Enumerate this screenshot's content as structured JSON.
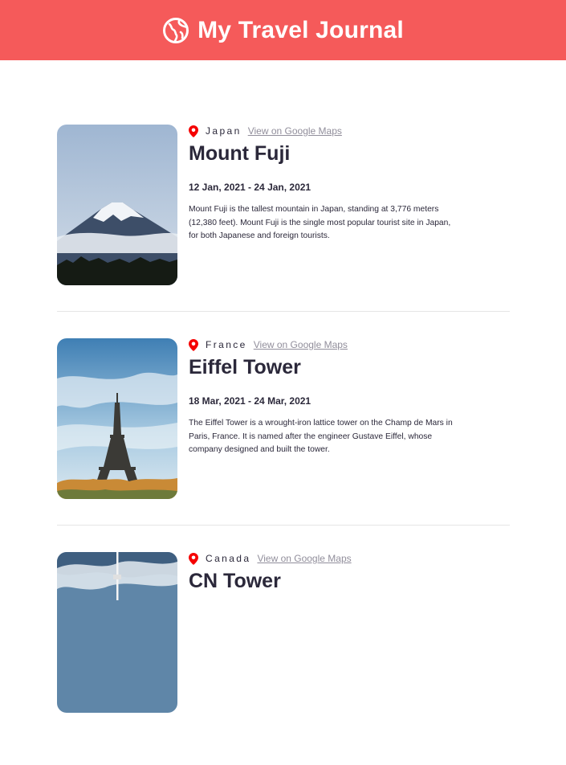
{
  "header": {
    "title": "My Travel Journal",
    "icon": "globe-icon"
  },
  "colors": {
    "header_bg": "#f55a5a",
    "pin": "#f50000",
    "link": "#918e9b"
  },
  "entries": [
    {
      "country": "Japan",
      "map_link": "View on Google Maps",
      "title": "Mount Fuji",
      "dates": "12 Jan, 2021 - 24 Jan, 2021",
      "description": "Mount Fuji is the tallest mountain in Japan, standing at 3,776 meters (12,380 feet). Mount Fuji is the single most popular tourist site in Japan, for both Japanese and foreign tourists."
    },
    {
      "country": "France",
      "map_link": "View on Google Maps",
      "title": "Eiffel Tower",
      "dates": "18 Mar, 2021 - 24 Mar, 2021",
      "description": "The Eiffel Tower is a wrought-iron lattice tower on the Champ de Mars in Paris, France. It is named after the engineer Gustave Eiffel, whose company designed and built the tower."
    },
    {
      "country": "Canada",
      "map_link": "View on Google Maps",
      "title": "CN Tower",
      "dates": "",
      "description": ""
    }
  ]
}
